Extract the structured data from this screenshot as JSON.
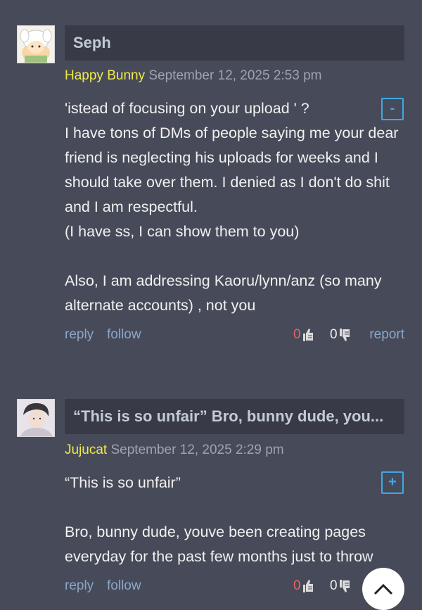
{
  "comments": [
    {
      "title": "Seph",
      "author": "Happy Bunny",
      "date": "September 12, 2025 2:53 pm",
      "toggle": "-",
      "body": "'istead of focusing on your upload ' ?\nI have tons of DMs of people saying me your dear friend is neglecting his uploads for weeks and I should take over them. I denied as I don't do shit and I am respectful.\n(I have ss, I can show them to you)\n\nAlso, I am addressing Kaoru/lynn/anz (so many alternate accounts) , not you",
      "reply_label": "reply",
      "follow_label": "follow",
      "upvotes": "0",
      "downvotes": "0",
      "report_label": "report"
    },
    {
      "title": "“This is so unfair” Bro, bunny dude, you...",
      "author": "Jujucat",
      "date": "September 12, 2025 2:29 pm",
      "toggle": "+",
      "body": "“This is so unfair”\n\nBro, bunny dude, youve been creating pages everyday for the past few months just to throw",
      "reply_label": "reply",
      "follow_label": "follow",
      "upvotes": "0",
      "downvotes": "0"
    }
  ],
  "colors": {
    "background": "#474b59",
    "title_bar": "#383b47",
    "author": "#f1e94c",
    "link": "#8aa7c8",
    "upvote": "#e86363",
    "toggle": "#3da8e6"
  },
  "icons": {
    "upvote": "thumbs-up-icon",
    "downvote": "thumbs-down-icon",
    "scroll_top": "chevron-up-icon"
  }
}
